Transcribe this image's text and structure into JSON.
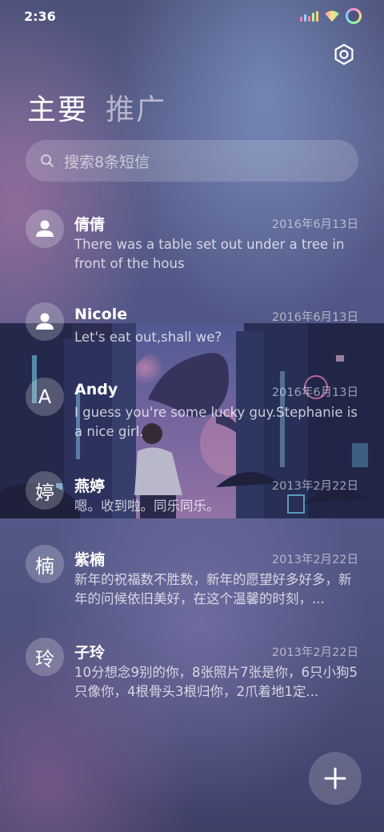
{
  "status_bar": {
    "time": "2:36"
  },
  "tabs": [
    {
      "label": "主要",
      "active": true
    },
    {
      "label": "推广",
      "active": false
    }
  ],
  "search": {
    "placeholder": "搜索8条短信"
  },
  "conversations": [
    {
      "avatar": "",
      "avatar_icon": "person-icon",
      "name": "倩倩",
      "date": "2016年6月13日",
      "preview": "There was a table set out under a tree in front of the hous"
    },
    {
      "avatar": "",
      "avatar_icon": "person-icon",
      "name": "Nicole",
      "date": "2016年6月13日",
      "preview": "Let's eat out,shall we?"
    },
    {
      "avatar": "A",
      "avatar_icon": "",
      "name": "Andy",
      "date": "2016年6月13日",
      "preview": "I guess you're some lucky guy.Stephanie is a nice girl."
    },
    {
      "avatar": "婷",
      "avatar_icon": "",
      "name": "燕婷",
      "date": "2013年2月22日",
      "preview": "嗯。收到啦。同乐同乐。"
    },
    {
      "avatar": "楠",
      "avatar_icon": "",
      "name": "紫楠",
      "date": "2013年2月22日",
      "preview": "新年的祝福数不胜数，新年的愿望好多好多，新年的问候依旧美好，在这个温馨的时刻，..."
    },
    {
      "avatar": "玲",
      "avatar_icon": "",
      "name": "子玲",
      "date": "2013年2月22日",
      "preview": "10分想念9别的你，8张照片7张是你，6只小狗5只像你，4根骨头3根归你，2爪着地1定..."
    }
  ],
  "colors": {
    "background": "#4f5685",
    "accent": "#ffffff"
  }
}
